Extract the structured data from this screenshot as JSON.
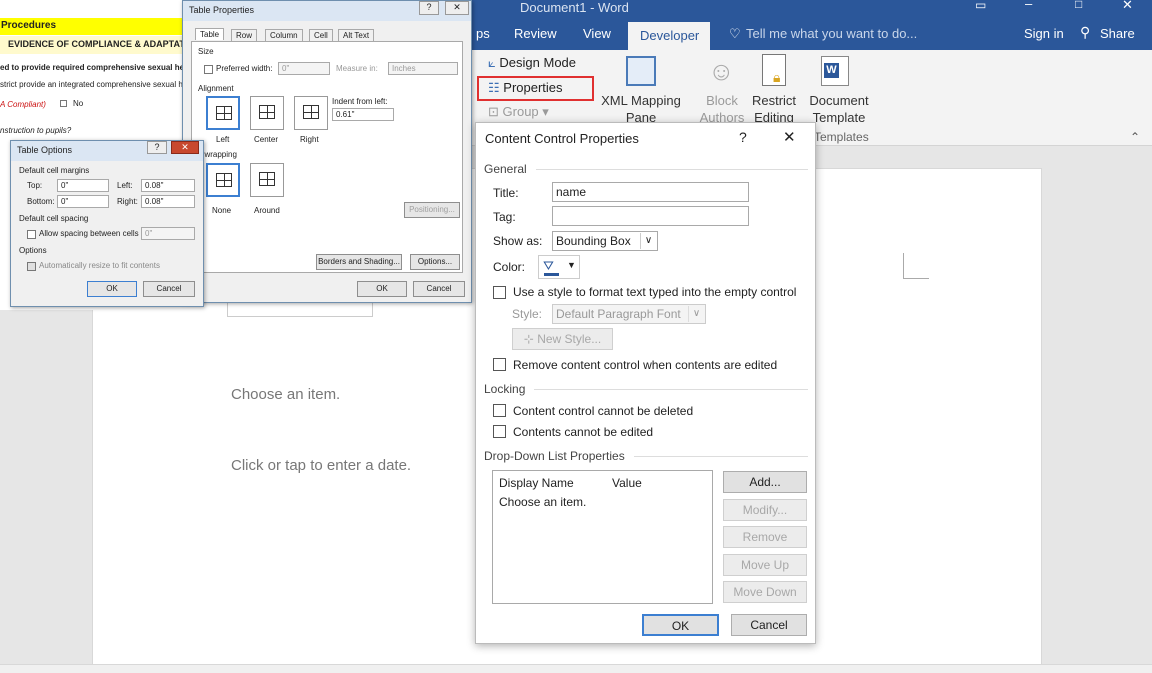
{
  "word": {
    "title": "Document1 - Word",
    "tabs": [
      "ps",
      "Review",
      "View",
      "Developer"
    ],
    "tell_me": "Tell me what you want to do...",
    "sign_in": "Sign in",
    "share": "Share",
    "ribbon": {
      "design_mode": "Design Mode",
      "properties": "Properties",
      "group": "Group",
      "xml_mapping_1": "XML Mapping",
      "xml_mapping_2": "Pane",
      "block_1": "Block",
      "block_2": "Authors",
      "restrict_1": "Restrict",
      "restrict_2": "Editing",
      "template_1": "Document",
      "template_2": "Template",
      "templates_group": "Templates"
    },
    "document": {
      "choose_item": "Choose an item.",
      "date_placeholder": "Click or tap to enter a date."
    }
  },
  "bgdoc": {
    "procedures": "Procedures",
    "evidence": "EVIDENCE OF COMPLIANCE & ADAPTATIO",
    "line1": "ed to provide required comprehensive sexual health a",
    "line2": "strict provide an integrated comprehensive sexual healt",
    "compliant": "A Compliant)",
    "no": "No",
    "instruction": "nstruction to pupils?"
  },
  "table_props": {
    "title": "Table Properties",
    "tabs": [
      "Table",
      "Row",
      "Column",
      "Cell",
      "Alt Text"
    ],
    "size": "Size",
    "preferred_width": "Preferred width:",
    "width_val": "0\"",
    "measure_in": "Measure in:",
    "measure_val": "Inches",
    "alignment": "Alignment",
    "align_options": [
      "Left",
      "Center",
      "Right"
    ],
    "indent_label": "Indent from left:",
    "indent_val": "0.61\"",
    "text_wrapping": "xt wrapping",
    "wrap_options": [
      "None",
      "Around"
    ],
    "positioning": "Positioning...",
    "borders": "Borders and Shading...",
    "options": "Options...",
    "ok": "OK",
    "cancel": "Cancel"
  },
  "table_options": {
    "title": "Table Options",
    "margins": "Default cell margins",
    "top": "Top:",
    "top_val": "0\"",
    "left": "Left:",
    "left_val": "0.08\"",
    "bottom": "Bottom:",
    "bottom_val": "0\"",
    "right": "Right:",
    "right_val": "0.08\"",
    "spacing": "Default cell spacing",
    "allow_spacing": "Allow spacing between cells",
    "spacing_val": "0\"",
    "options": "Options",
    "auto_resize": "Automatically resize to fit contents",
    "ok": "OK",
    "cancel": "Cancel"
  },
  "ccp": {
    "title": "Content Control Properties",
    "help": "?",
    "close": "✕",
    "general": "General",
    "title_label": "Title:",
    "title_val": "name",
    "tag_label": "Tag:",
    "tag_val": "",
    "show_as_label": "Show as:",
    "show_as_val": "Bounding Box",
    "color_label": "Color:",
    "use_style": "Use a style to format text typed into the empty control",
    "style_label": "Style:",
    "style_val": "Default Paragraph Font",
    "new_style": "New Style...",
    "remove_cc": "Remove content control when contents are edited",
    "locking": "Locking",
    "lock_delete": "Content control cannot be deleted",
    "lock_edit": "Contents cannot be edited",
    "ddl": "Drop-Down List Properties",
    "col_display": "Display Name",
    "col_value": "Value",
    "items": [
      "Choose an item."
    ],
    "add": "Add...",
    "modify": "Modify...",
    "remove": "Remove",
    "move_up": "Move Up",
    "move_down": "Move Down",
    "ok": "OK",
    "cancel": "Cancel"
  },
  "colors": {
    "word_blue": "#2b579a",
    "highlight_red": "#e03030"
  }
}
